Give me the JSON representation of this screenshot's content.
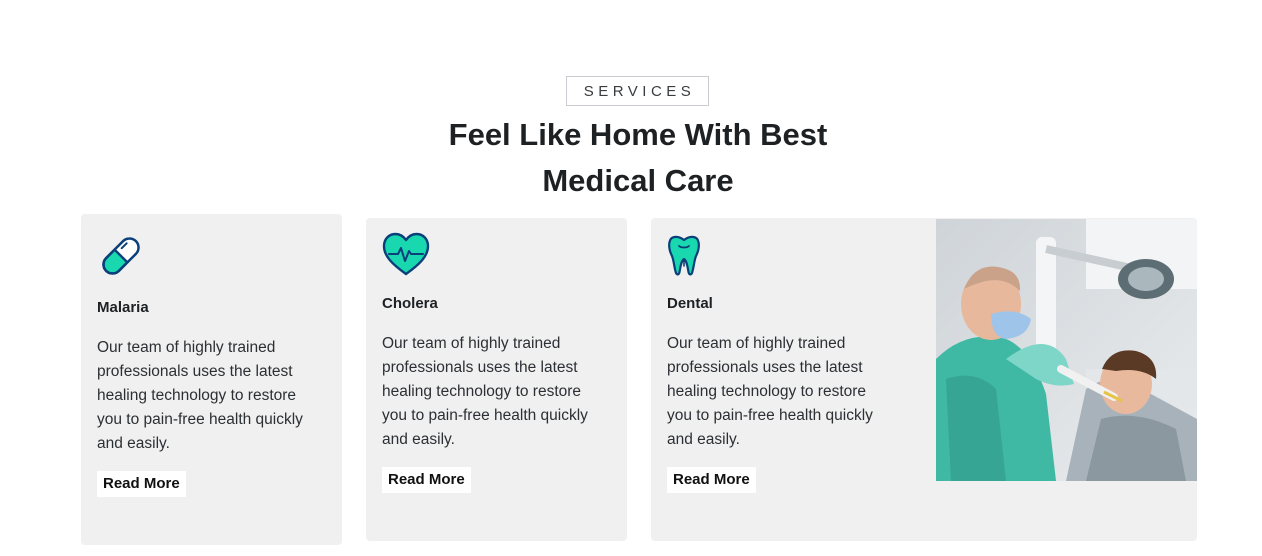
{
  "section": {
    "eyebrow": "SERVICES",
    "title_line1": "Feel Like Home With Best",
    "title_line2": "Medical Care"
  },
  "colors": {
    "accent": "#19d8b0",
    "icon_outline": "#0b3f7a",
    "card_bg": "#f0f0f0"
  },
  "cards": [
    {
      "icon": "pill-icon",
      "name": "Malaria",
      "description": "Our team of highly trained professionals uses the latest healing technology to restore you to pain-free health quickly and easily.",
      "button": "Read More"
    },
    {
      "icon": "heart-pulse-icon",
      "name": "Cholera",
      "description": "Our team of highly trained professionals uses the latest healing technology to restore you to pain-free health quickly and easily.",
      "button": "Read More"
    },
    {
      "icon": "tooth-icon",
      "name": "Dental",
      "description": "Our team of highly trained professionals uses the latest healing technology to restore you to pain-free health quickly and easily.",
      "button": "Read More"
    }
  ],
  "feature_image": {
    "subject": "dentist treating a patient"
  }
}
